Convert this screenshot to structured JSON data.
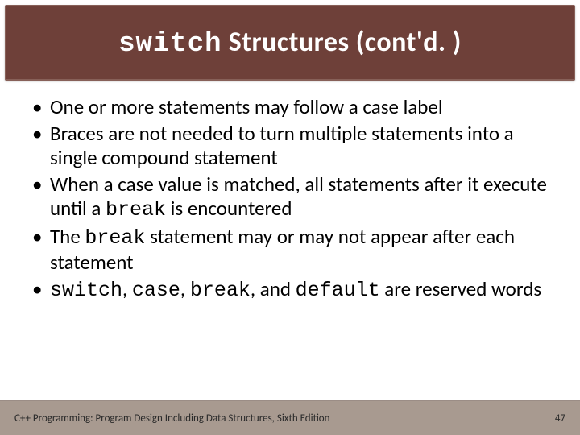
{
  "title": {
    "keyword": "switch",
    "rest": " Structures (cont'd. )"
  },
  "bullets": [
    {
      "segments": [
        {
          "t": "One or more statements may follow a case label",
          "mono": false
        }
      ]
    },
    {
      "segments": [
        {
          "t": "Braces are not needed to turn multiple statements into a single compound statement",
          "mono": false
        }
      ]
    },
    {
      "segments": [
        {
          "t": "When a case value is matched, all statements after it execute until a ",
          "mono": false
        },
        {
          "t": "break",
          "mono": true
        },
        {
          "t": " is encountered",
          "mono": false
        }
      ]
    },
    {
      "segments": [
        {
          "t": "The ",
          "mono": false
        },
        {
          "t": "break",
          "mono": true
        },
        {
          "t": " statement may or may not appear after each statement",
          "mono": false
        }
      ]
    },
    {
      "segments": [
        {
          "t": "switch",
          "mono": true
        },
        {
          "t": ", ",
          "mono": false
        },
        {
          "t": "case",
          "mono": true
        },
        {
          "t": ", ",
          "mono": false
        },
        {
          "t": "break",
          "mono": true
        },
        {
          "t": ", and ",
          "mono": false
        },
        {
          "t": "default",
          "mono": true
        },
        {
          "t": " are reserved words",
          "mono": false
        }
      ]
    }
  ],
  "footer": {
    "left": "C++ Programming: Program Design Including Data Structures, Sixth Edition",
    "page": "47"
  }
}
